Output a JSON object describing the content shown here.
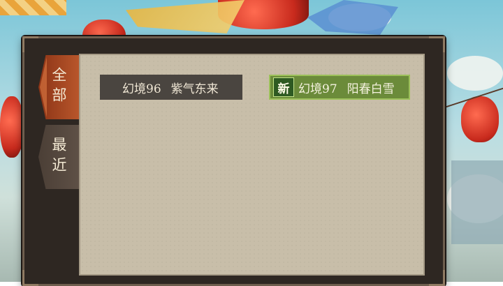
{
  "tabs": [
    {
      "label": "全部",
      "active": true
    },
    {
      "label": "最近",
      "active": false
    }
  ],
  "items": [
    {
      "level": "幻境96",
      "name": "紫气东来",
      "is_new": false
    },
    {
      "level": "幻境97",
      "name": "阳春白雪",
      "is_new": true,
      "badge": "新"
    }
  ],
  "colors": {
    "active_tab": "#b8562b",
    "new_item_bg": "#6b8b3a",
    "item_bg": "#4a4540",
    "paper": "#c8bea9"
  }
}
